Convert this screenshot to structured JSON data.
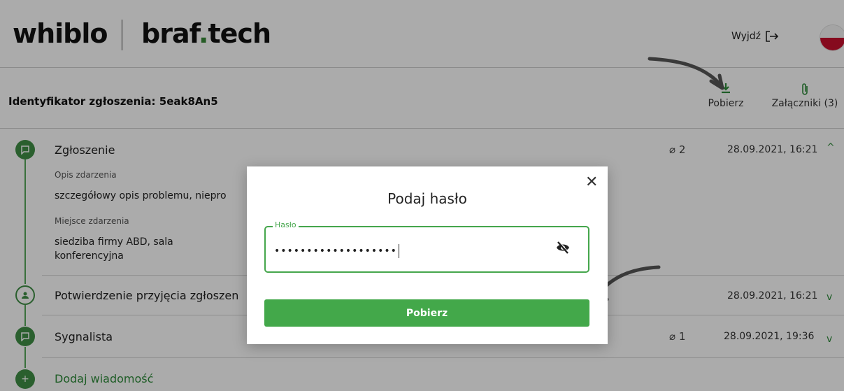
{
  "header": {
    "logo_left": "whiblo",
    "logo_right_main": "braf",
    "logo_right_dot": ".",
    "logo_right_end": "tech",
    "logout_label": "Wyjdź",
    "logout_icon": "exit-icon",
    "language": "pl-flag"
  },
  "report": {
    "id_label": "Identyfikator zgłoszenia: 5eak8An5",
    "download_label": "Pobierz",
    "attachments_label": "Załączniki (3)"
  },
  "timeline": {
    "items": [
      {
        "title": "Zgłoszenie",
        "attachments": "2",
        "date": "28.09.2021, 16:21",
        "expanded": true,
        "fields": [
          {
            "label": "Opis zdarzenia",
            "value": "szczegółowy opis  problemu, niepro"
          },
          {
            "label": "Miejsce zdarzenia",
            "value": "siedziba firmy ABD, sala konferencyjna"
          }
        ]
      },
      {
        "title": "Potwierdzenie przyjęcia zgłoszen",
        "date": "28.09.2021, 16:21"
      },
      {
        "title": "Sygnalista",
        "attachments": "1",
        "date": "28.09.2021, 19:36"
      }
    ],
    "add_message": "Dodaj wiadomość"
  },
  "modal": {
    "title": "Podaj hasło",
    "field_label": "Hasło",
    "password_masked": "•••••••••••••••••••",
    "submit_label": "Pobierz"
  },
  "colors": {
    "accent": "#43a84a",
    "flag_red": "#c8102e"
  }
}
